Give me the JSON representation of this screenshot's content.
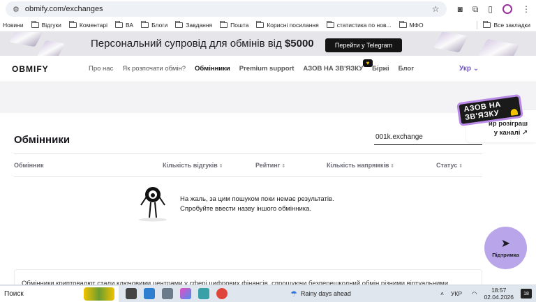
{
  "browser": {
    "url": "obmify.com/exchanges",
    "bookmarks": [
      {
        "label": "Новини",
        "folder": false
      },
      {
        "label": "Відгуки",
        "folder": true
      },
      {
        "label": "Коментарі",
        "folder": true
      },
      {
        "label": "ВА",
        "folder": true
      },
      {
        "label": "Блоги",
        "folder": true
      },
      {
        "label": "Завдання",
        "folder": true
      },
      {
        "label": "Пошта",
        "folder": true
      },
      {
        "label": "Корисні посилання",
        "folder": true
      },
      {
        "label": "статистика по нов...",
        "folder": true
      },
      {
        "label": "МФО",
        "folder": true
      }
    ],
    "all_bookmarks": "Все закладки"
  },
  "promo": {
    "text": "Персональний супровід для обмінів від",
    "amount": "$5000",
    "button": "Перейти у Telegram"
  },
  "header": {
    "logo": "OBMIFY",
    "nav": [
      {
        "label": "Про нас",
        "style": ""
      },
      {
        "label": "Як розпочати обмін?",
        "style": ""
      },
      {
        "label": "Обмінники",
        "style": "active"
      },
      {
        "label": "Premium support",
        "style": "bold"
      },
      {
        "label": "АЗОВ НА ЗВ'ЯЗКУ",
        "style": "bold"
      },
      {
        "label": "Біржі",
        "style": "bold"
      },
      {
        "label": "Блог",
        "style": "bold"
      }
    ],
    "language": "Укр"
  },
  "azov": {
    "sticker_line1": "АЗОВ НА",
    "sticker_line2": "ЗВ'ЯЗКУ",
    "card_line1": "ир розіграш",
    "card_line2": "у каналі ↗"
  },
  "main": {
    "title": "Обмінники",
    "search_value": "001k.exchange",
    "columns": [
      {
        "label": "Обмінник",
        "sortable": false
      },
      {
        "label": "Кількість відгуків",
        "sortable": true
      },
      {
        "label": "Рейтинг",
        "sortable": true
      },
      {
        "label": "Кількість напрямків",
        "sortable": true
      },
      {
        "label": "Статус",
        "sortable": true
      }
    ],
    "empty_line1": "На жаль, за цим пошуком поки немає результатів.",
    "empty_line2": "Спробуйте ввести назву іншого обмінника.",
    "support": "Підтримка",
    "info_text": "Обмінники криптовалют стали ключовими центрами у сфері цифрових фінансів, спрощуючи безперешкодний обмін різними віртуальними"
  },
  "taskbar": {
    "search": "Поиск",
    "weather": "Rainy days ahead",
    "lang": "УКР",
    "time": "18:57",
    "date": "02.04.2026",
    "notifications": "18"
  },
  "colors": {
    "accent": "#6a4dc8",
    "support_bg": "#b9a6ea",
    "promo_bg": "#e6e6ea"
  }
}
